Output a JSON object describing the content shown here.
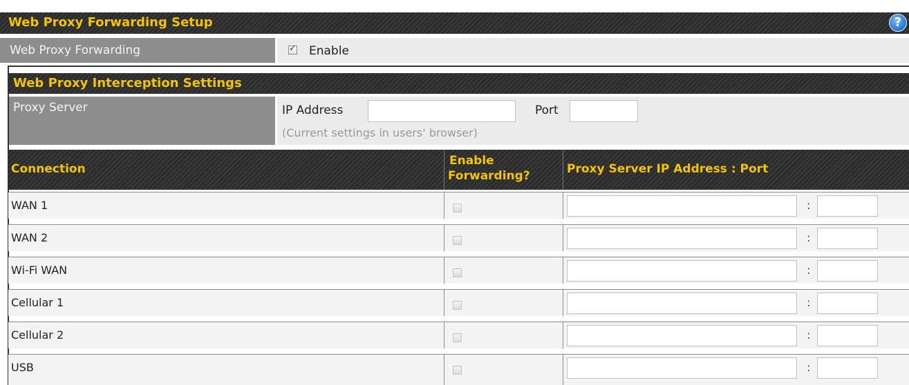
{
  "setup": {
    "title": "Web Proxy Forwarding Setup",
    "help_icon": "?",
    "forwarding_label": "Web Proxy Forwarding",
    "enable_label": "Enable",
    "enable_checked": true
  },
  "interception": {
    "title": "Web Proxy Interception Settings",
    "proxy_server_label": "Proxy Server",
    "ip_label": "IP Address",
    "ip_value": "",
    "port_label": "Port",
    "port_value": "",
    "hint": "(Current settings in users' browser)"
  },
  "table": {
    "headers": {
      "connection": "Connection",
      "enable_forwarding_line1": "Enable",
      "enable_forwarding_line2": "Forwarding?",
      "proxy_addr": "Proxy Server IP Address : Port"
    },
    "separator": ":",
    "rows": [
      {
        "name": "WAN 1",
        "enabled": false,
        "ip": "",
        "port": ""
      },
      {
        "name": "WAN 2",
        "enabled": false,
        "ip": "",
        "port": ""
      },
      {
        "name": "Wi-Fi WAN",
        "enabled": false,
        "ip": "",
        "port": ""
      },
      {
        "name": "Cellular 1",
        "enabled": false,
        "ip": "",
        "port": ""
      },
      {
        "name": "Cellular 2",
        "enabled": false,
        "ip": "",
        "port": ""
      },
      {
        "name": "USB",
        "enabled": false,
        "ip": "",
        "port": ""
      }
    ]
  },
  "colors": {
    "header_gold": "#f5c400",
    "header_dark": "#2b2b2b",
    "label_gray": "#8d8d8d",
    "help_blue": "#2f7fd6"
  },
  "icons": {
    "help": "help-icon",
    "checkbox": "checkbox-icon"
  }
}
